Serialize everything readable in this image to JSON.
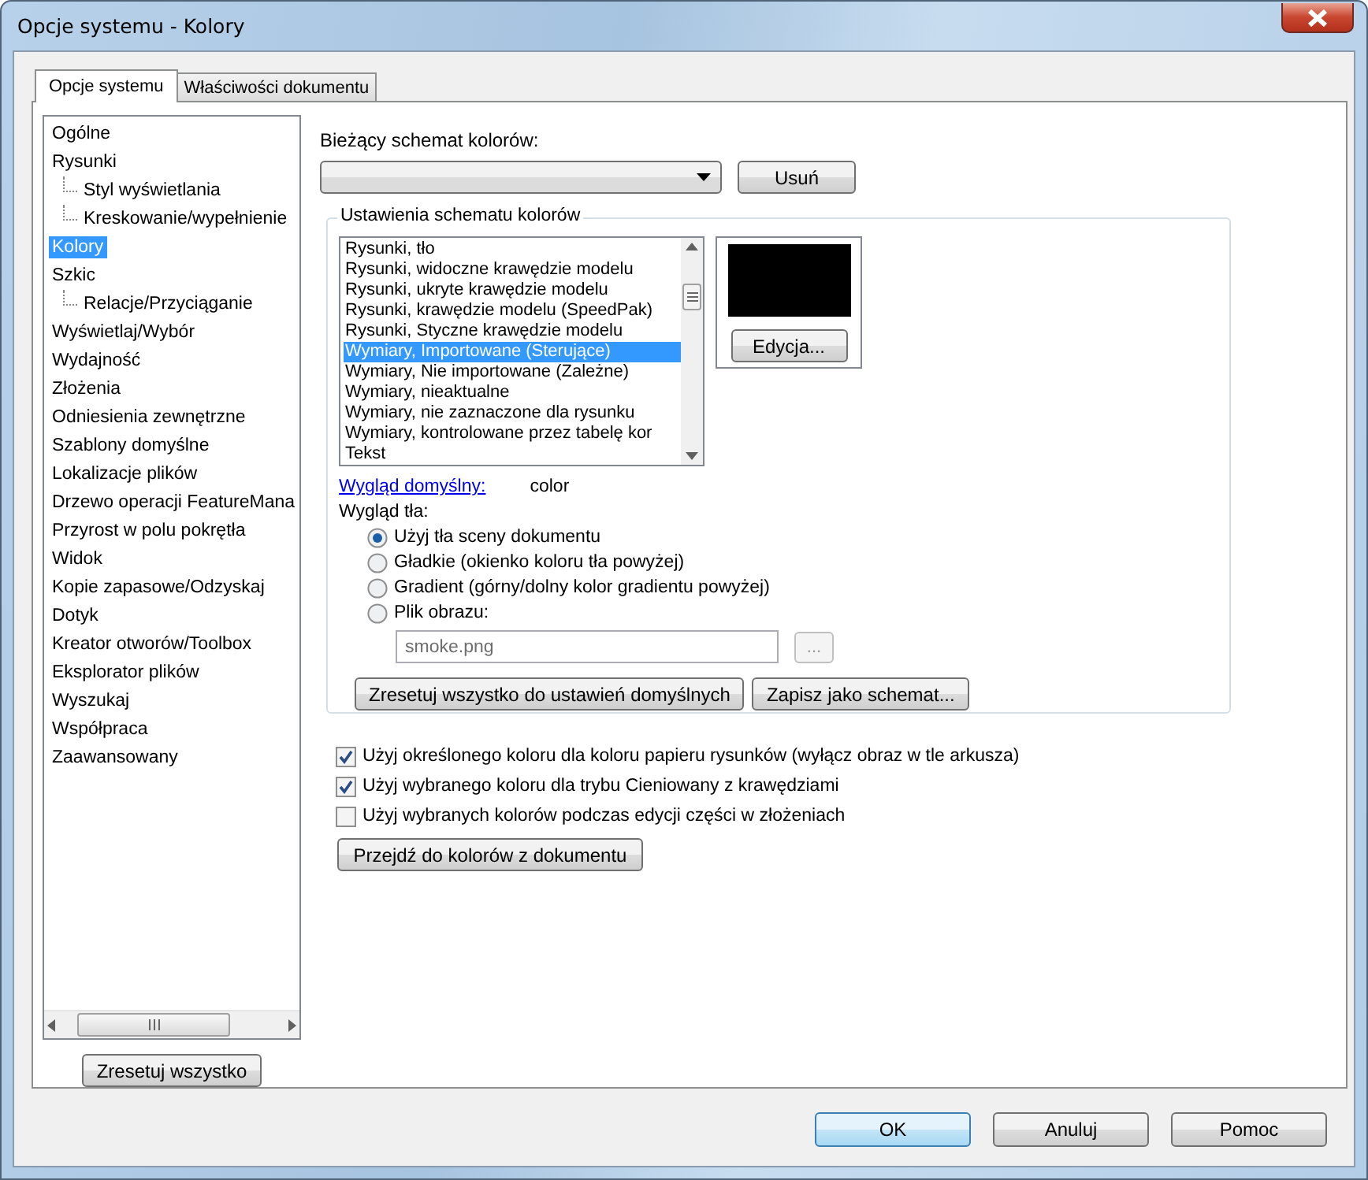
{
  "window": {
    "title": "Opcje systemu - Kolory"
  },
  "tabs": [
    {
      "label": "Opcje systemu",
      "selected": true
    },
    {
      "label": "Właściwości dokumentu",
      "selected": false
    }
  ],
  "tree": {
    "items": [
      {
        "label": "Ogólne",
        "selected": false
      },
      {
        "label": "Rysunki",
        "selected": false,
        "children": [
          {
            "label": "Styl wyświetlania",
            "selected": false
          },
          {
            "label": "Kreskowanie/wypełnienie",
            "selected": false
          }
        ]
      },
      {
        "label": "Kolory",
        "selected": true
      },
      {
        "label": "Szkic",
        "selected": false,
        "children": [
          {
            "label": "Relacje/Przyciąganie",
            "selected": false
          }
        ]
      },
      {
        "label": "Wyświetlaj/Wybór",
        "selected": false
      },
      {
        "label": "Wydajność",
        "selected": false
      },
      {
        "label": "Złożenia",
        "selected": false
      },
      {
        "label": "Odniesienia zewnętrzne",
        "selected": false
      },
      {
        "label": "Szablony domyślne",
        "selected": false
      },
      {
        "label": "Lokalizacje plików",
        "selected": false
      },
      {
        "label": "Drzewo operacji FeatureMana",
        "selected": false
      },
      {
        "label": "Przyrost w polu pokrętła",
        "selected": false
      },
      {
        "label": "Widok",
        "selected": false
      },
      {
        "label": "Kopie zapasowe/Odzyskaj",
        "selected": false
      },
      {
        "label": "Dotyk",
        "selected": false
      },
      {
        "label": "Kreator otworów/Toolbox",
        "selected": false
      },
      {
        "label": "Eksplorator plików",
        "selected": false
      },
      {
        "label": "Wyszukaj",
        "selected": false
      },
      {
        "label": "Współpraca",
        "selected": false
      },
      {
        "label": "Zaawansowany",
        "selected": false
      }
    ],
    "reset_button": "Zresetuj wszystko"
  },
  "scheme": {
    "label": "Bieżący schemat kolorów:",
    "delete_button": "Usuń"
  },
  "group": {
    "title": "Ustawienia schematu kolorów",
    "items": [
      {
        "label": "Rysunki, tło",
        "selected": false
      },
      {
        "label": "Rysunki, widoczne krawędzie modelu",
        "selected": false
      },
      {
        "label": "Rysunki, ukryte krawędzie modelu",
        "selected": false
      },
      {
        "label": "Rysunki, krawędzie modelu (SpeedPak)",
        "selected": false
      },
      {
        "label": "Rysunki, Styczne krawędzie modelu",
        "selected": false
      },
      {
        "label": "Wymiary, Importowane (Sterujące)",
        "selected": true
      },
      {
        "label": "Wymiary, Nie importowane (Zależne)",
        "selected": false
      },
      {
        "label": "Wymiary, nieaktualne",
        "selected": false
      },
      {
        "label": "Wymiary, nie zaznaczone dla rysunku",
        "selected": false
      },
      {
        "label": "Wymiary, kontrolowane przez tabelę kor",
        "selected": false
      },
      {
        "label": "Tekst",
        "selected": false
      }
    ],
    "edit_button": "Edycja...",
    "default_link": "Wygląd domyślny:",
    "default_value": "color",
    "background_label": "Wygląd tła:",
    "radios": [
      {
        "label": "Użyj tła sceny dokumentu",
        "selected": true
      },
      {
        "label": "Gładkie (okienko koloru tła powyżej)",
        "selected": false
      },
      {
        "label": "Gradient (górny/dolny kolor gradientu powyżej)",
        "selected": false
      },
      {
        "label": "Plik obrazu:",
        "selected": false
      }
    ],
    "image_file": {
      "value": "smoke.png",
      "disabled": true
    },
    "browse_button": {
      "label": "...",
      "disabled": true
    },
    "reset_defaults_button": "Zresetuj wszystko do ustawień domyślnych",
    "save_button": "Zapisz jako schemat..."
  },
  "checkboxes": [
    {
      "label": "Użyj określonego koloru dla koloru papieru rysunków (wyłącz obraz w tle arkusza)",
      "checked": true
    },
    {
      "label": "Użyj wybranego koloru dla trybu Cieniowany z krawędziami",
      "checked": true
    },
    {
      "label": "Użyj wybranych kolorów podczas edycji części w złożeniach",
      "checked": false
    }
  ],
  "document_colors_button": "Przejdź do kolorów z dokumentu",
  "footer_buttons": [
    {
      "label": "OK",
      "default": true
    },
    {
      "label": "Anuluj",
      "default": false
    },
    {
      "label": "Pomoc",
      "default": false
    }
  ]
}
